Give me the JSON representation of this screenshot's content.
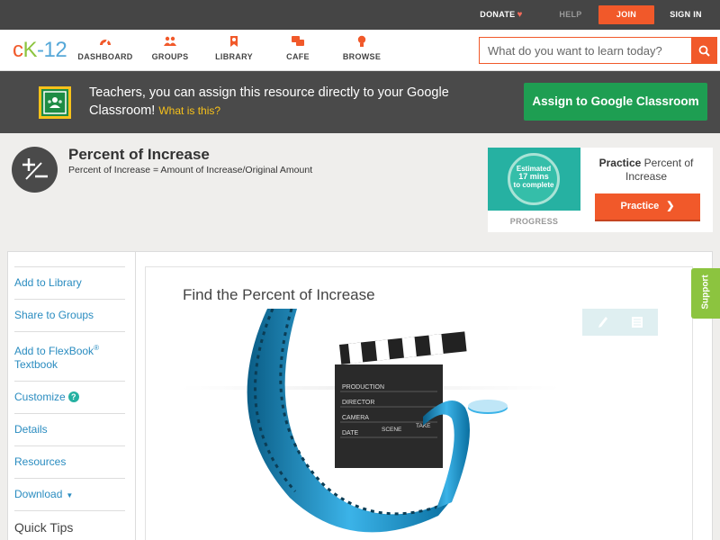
{
  "topbar": {
    "donate": "DONATE",
    "help": "HELP",
    "join": "JOIN",
    "signin": "SIGN IN"
  },
  "nav": {
    "logo": {
      "c": "c",
      "k": "K",
      "n": "-12"
    },
    "items": [
      {
        "label": "DASHBOARD",
        "icon": "dashboard-icon"
      },
      {
        "label": "GROUPS",
        "icon": "groups-icon"
      },
      {
        "label": "LIBRARY",
        "icon": "library-icon"
      },
      {
        "label": "CAFE",
        "icon": "cafe-icon"
      },
      {
        "label": "BROWSE",
        "icon": "browse-icon"
      }
    ],
    "search_placeholder": "What do you want to learn today?"
  },
  "banner": {
    "text": "Teachers, you can assign this resource directly to your Google Classroom!",
    "link": "What is this?",
    "button": "Assign to Google Classroom"
  },
  "concept": {
    "title": "Percent of Increase",
    "subtitle": "Percent of Increase = Amount of Increase/Original Amount"
  },
  "practice": {
    "estimate_line1": "Estimated",
    "estimate_line2": "17 mins",
    "estimate_line3": "to complete",
    "progress_label": "PROGRESS",
    "title_bold": "Practice",
    "title_rest": "Percent of Increase",
    "button": "Practice"
  },
  "sidebar": {
    "items": [
      {
        "label": "Add to Library"
      },
      {
        "label": "Share to Groups"
      },
      {
        "label": "Add to FlexBook",
        "sup": "®",
        "label2": "Textbook"
      },
      {
        "label": "Customize"
      },
      {
        "label": "Details"
      },
      {
        "label": "Resources"
      },
      {
        "label": "Download"
      }
    ],
    "quick_tips": "Quick Tips"
  },
  "main": {
    "title": "Find the Percent of Increase",
    "clapper": {
      "production": "PRODUCTION",
      "director": "DIRECTOR",
      "camera": "CAMERA",
      "date": "DATE",
      "scene": "SCENE",
      "take": "TAKE"
    }
  },
  "support": "Support",
  "colors": {
    "accent": "#f1592a",
    "green": "#1e9e52",
    "link": "#2a8cc0",
    "dark": "#454545",
    "support": "#8cc43f"
  }
}
